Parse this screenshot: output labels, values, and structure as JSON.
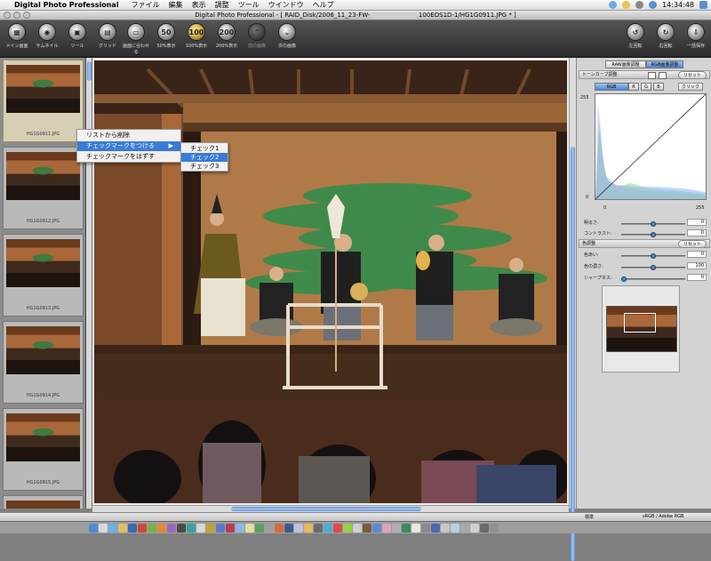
{
  "menubar": {
    "app": "Digital Photo Professional",
    "items": [
      "ファイル",
      "編集",
      "表示",
      "調整",
      "ツール",
      "ウインドウ",
      "ヘルプ"
    ],
    "clock": "14:34:48"
  },
  "window": {
    "title": "Digital Photo Professional - [ RAID_Disk/2006_11_23-FW-",
    "title_suffix": "100EOS1D-1/HG1G0911.JPG * ]"
  },
  "toolbar": {
    "left": [
      "メイン画面",
      "サムネイル",
      "ツール",
      "グリッド",
      "画面に合わせる",
      "50%表示",
      "100%表示",
      "200%表示",
      "前の画像",
      "次の画像"
    ],
    "right": [
      "左回転",
      "右回転",
      "一括保存"
    ]
  },
  "thumbnails": [
    "HG1G0911.JPG",
    "HG1G0912.JPG",
    "HG1G0913.JPG",
    "HG1G0914.JPG",
    "HG1G0915.JPG"
  ],
  "context_menu": {
    "items": [
      "リストから削除",
      "チェックマークをつける",
      "チェックマークをはずす"
    ],
    "submenu": [
      "チェック1",
      "チェック2",
      "チェック3"
    ]
  },
  "panel": {
    "tabs": [
      "RAW画像調整",
      "RGB画像調整"
    ],
    "tone_curve": "トーンカーブ調整",
    "reset": "リセット",
    "channels": [
      "RGB",
      "R",
      "G",
      "B"
    ],
    "click": "クリック",
    "y_top": "255",
    "y_bottom": "0",
    "x_left": "0",
    "x_right": "255",
    "brightness": "明るさ:",
    "brightness_val": "0",
    "contrast": "コントラスト:",
    "contrast_val": "0",
    "color": "色調整",
    "color_reset": "リセット",
    "hue": "色あい:",
    "hue_val": "0",
    "saturation": "色の濃さ:",
    "saturation_val": "100",
    "sharpness": "シャープネス:",
    "sharpness_val": "0"
  },
  "status": {
    "left": "標準",
    "right": "sRGB / Adobe RGB"
  },
  "colors": {
    "selection": "#3a7bd5",
    "scroll_accent": "#5b8fd6"
  }
}
